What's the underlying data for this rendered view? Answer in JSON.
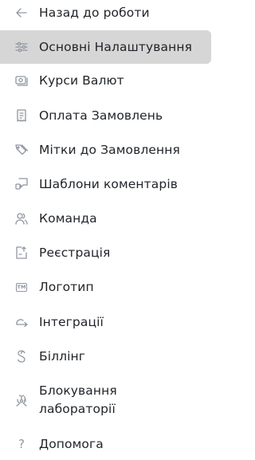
{
  "menu": {
    "items": [
      {
        "label": "Назад до роботи",
        "icon": "arrow-left-icon"
      },
      {
        "label": "Основні Налаштування",
        "icon": "sliders-icon",
        "active": true
      },
      {
        "label": "Курси Валют",
        "icon": "currency-icon"
      },
      {
        "label": "Оплата Замовлень",
        "icon": "receipt-icon"
      },
      {
        "label": "Мітки до Замовлення",
        "icon": "tags-icon"
      },
      {
        "label": "Шаблони коментарів",
        "icon": "comment-template-icon"
      },
      {
        "label": "Команда",
        "icon": "team-icon"
      },
      {
        "label": "Реєстрація",
        "icon": "registration-icon"
      },
      {
        "label": "Логотип",
        "icon": "trademark-icon",
        "icon_text": "TM"
      },
      {
        "label": "Інтеграції",
        "icon": "integration-arrow-icon"
      },
      {
        "label": "Біллінг",
        "icon": "billing-icon"
      },
      {
        "label": "Блокування лабораторії",
        "icon": "biohazard-icon"
      },
      {
        "label": "Допомога",
        "icon": "question-icon",
        "icon_text": "?"
      }
    ]
  },
  "colors": {
    "active_background": "#d6d6d6",
    "icon": "#9096a1",
    "text": "#1f2328"
  }
}
